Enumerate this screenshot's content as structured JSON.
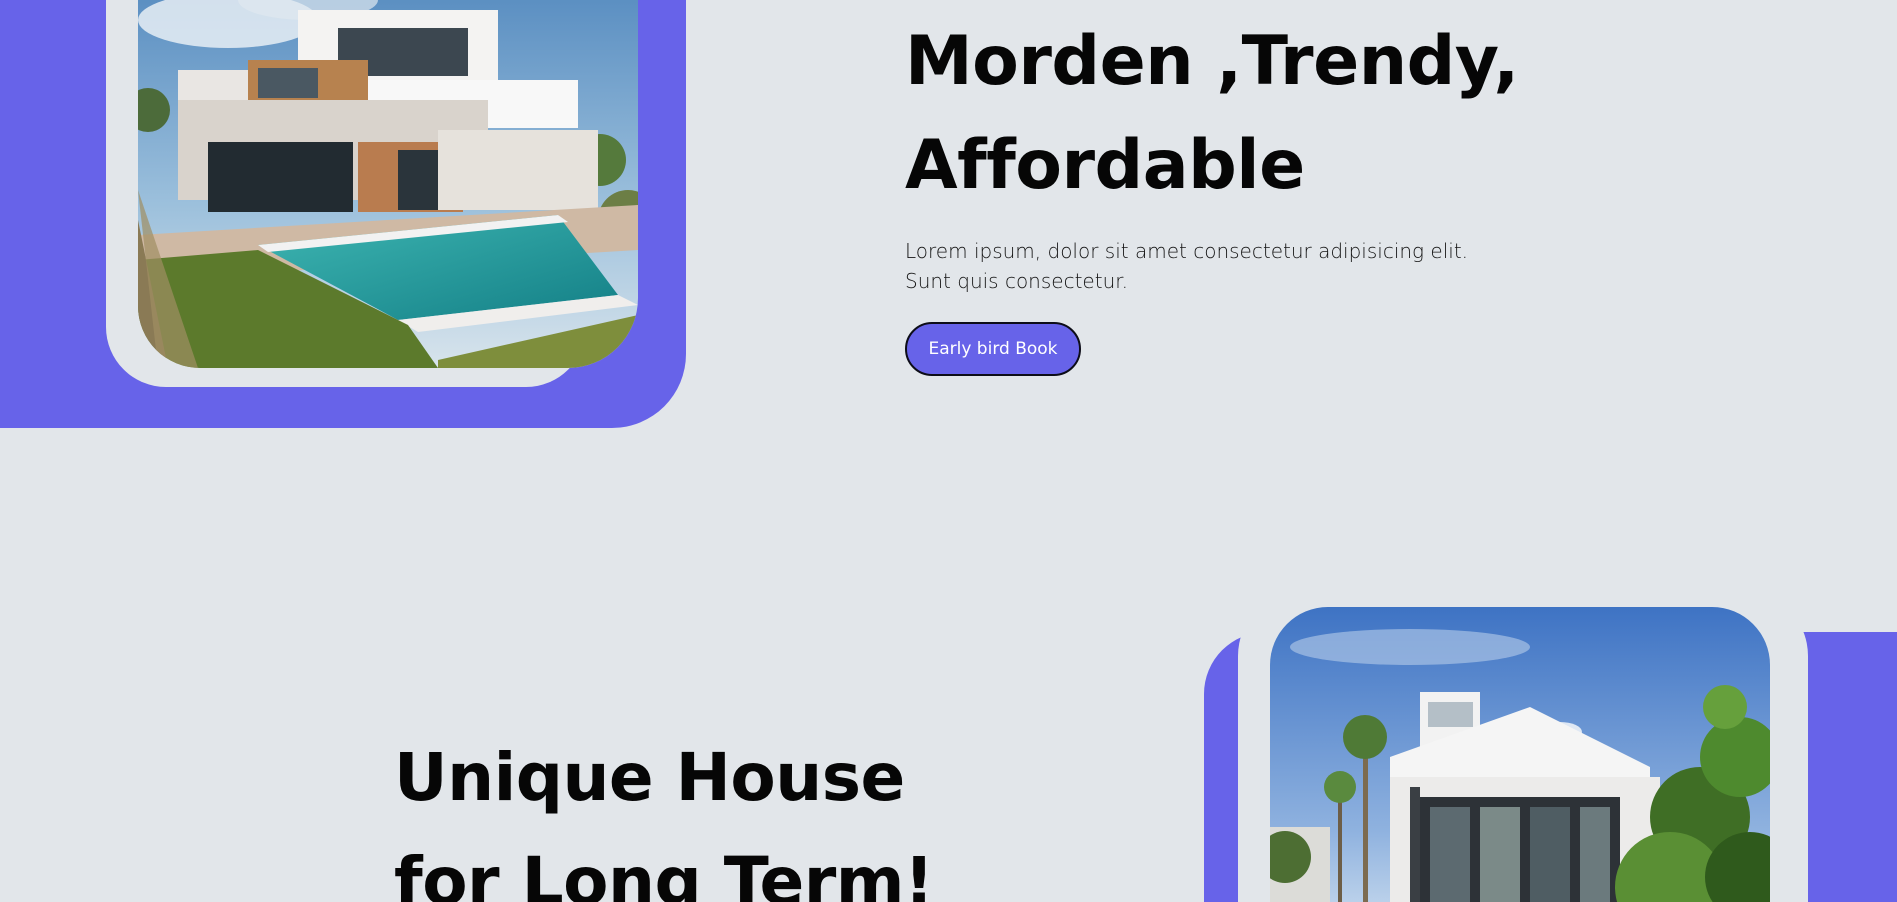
{
  "section_one": {
    "title_lines": [
      "Morden ,Trendy,",
      "Affordable"
    ],
    "description_lines": [
      "Lorem ipsum, dolor sit amet consectetur adipisicing elit.",
      "Sunt quis consectetur."
    ],
    "button_label": "Early bird Book",
    "image_icon": "modern-villa-with-pool-photo"
  },
  "section_two": {
    "title_lines": [
      "Unique House",
      "for Long Term!"
    ],
    "image_icon": "white-modern-house-photo"
  },
  "colors": {
    "background": "#e2e6ea",
    "accent": "#6763e9",
    "heading": "#060606",
    "button_text": "#ffffff"
  }
}
